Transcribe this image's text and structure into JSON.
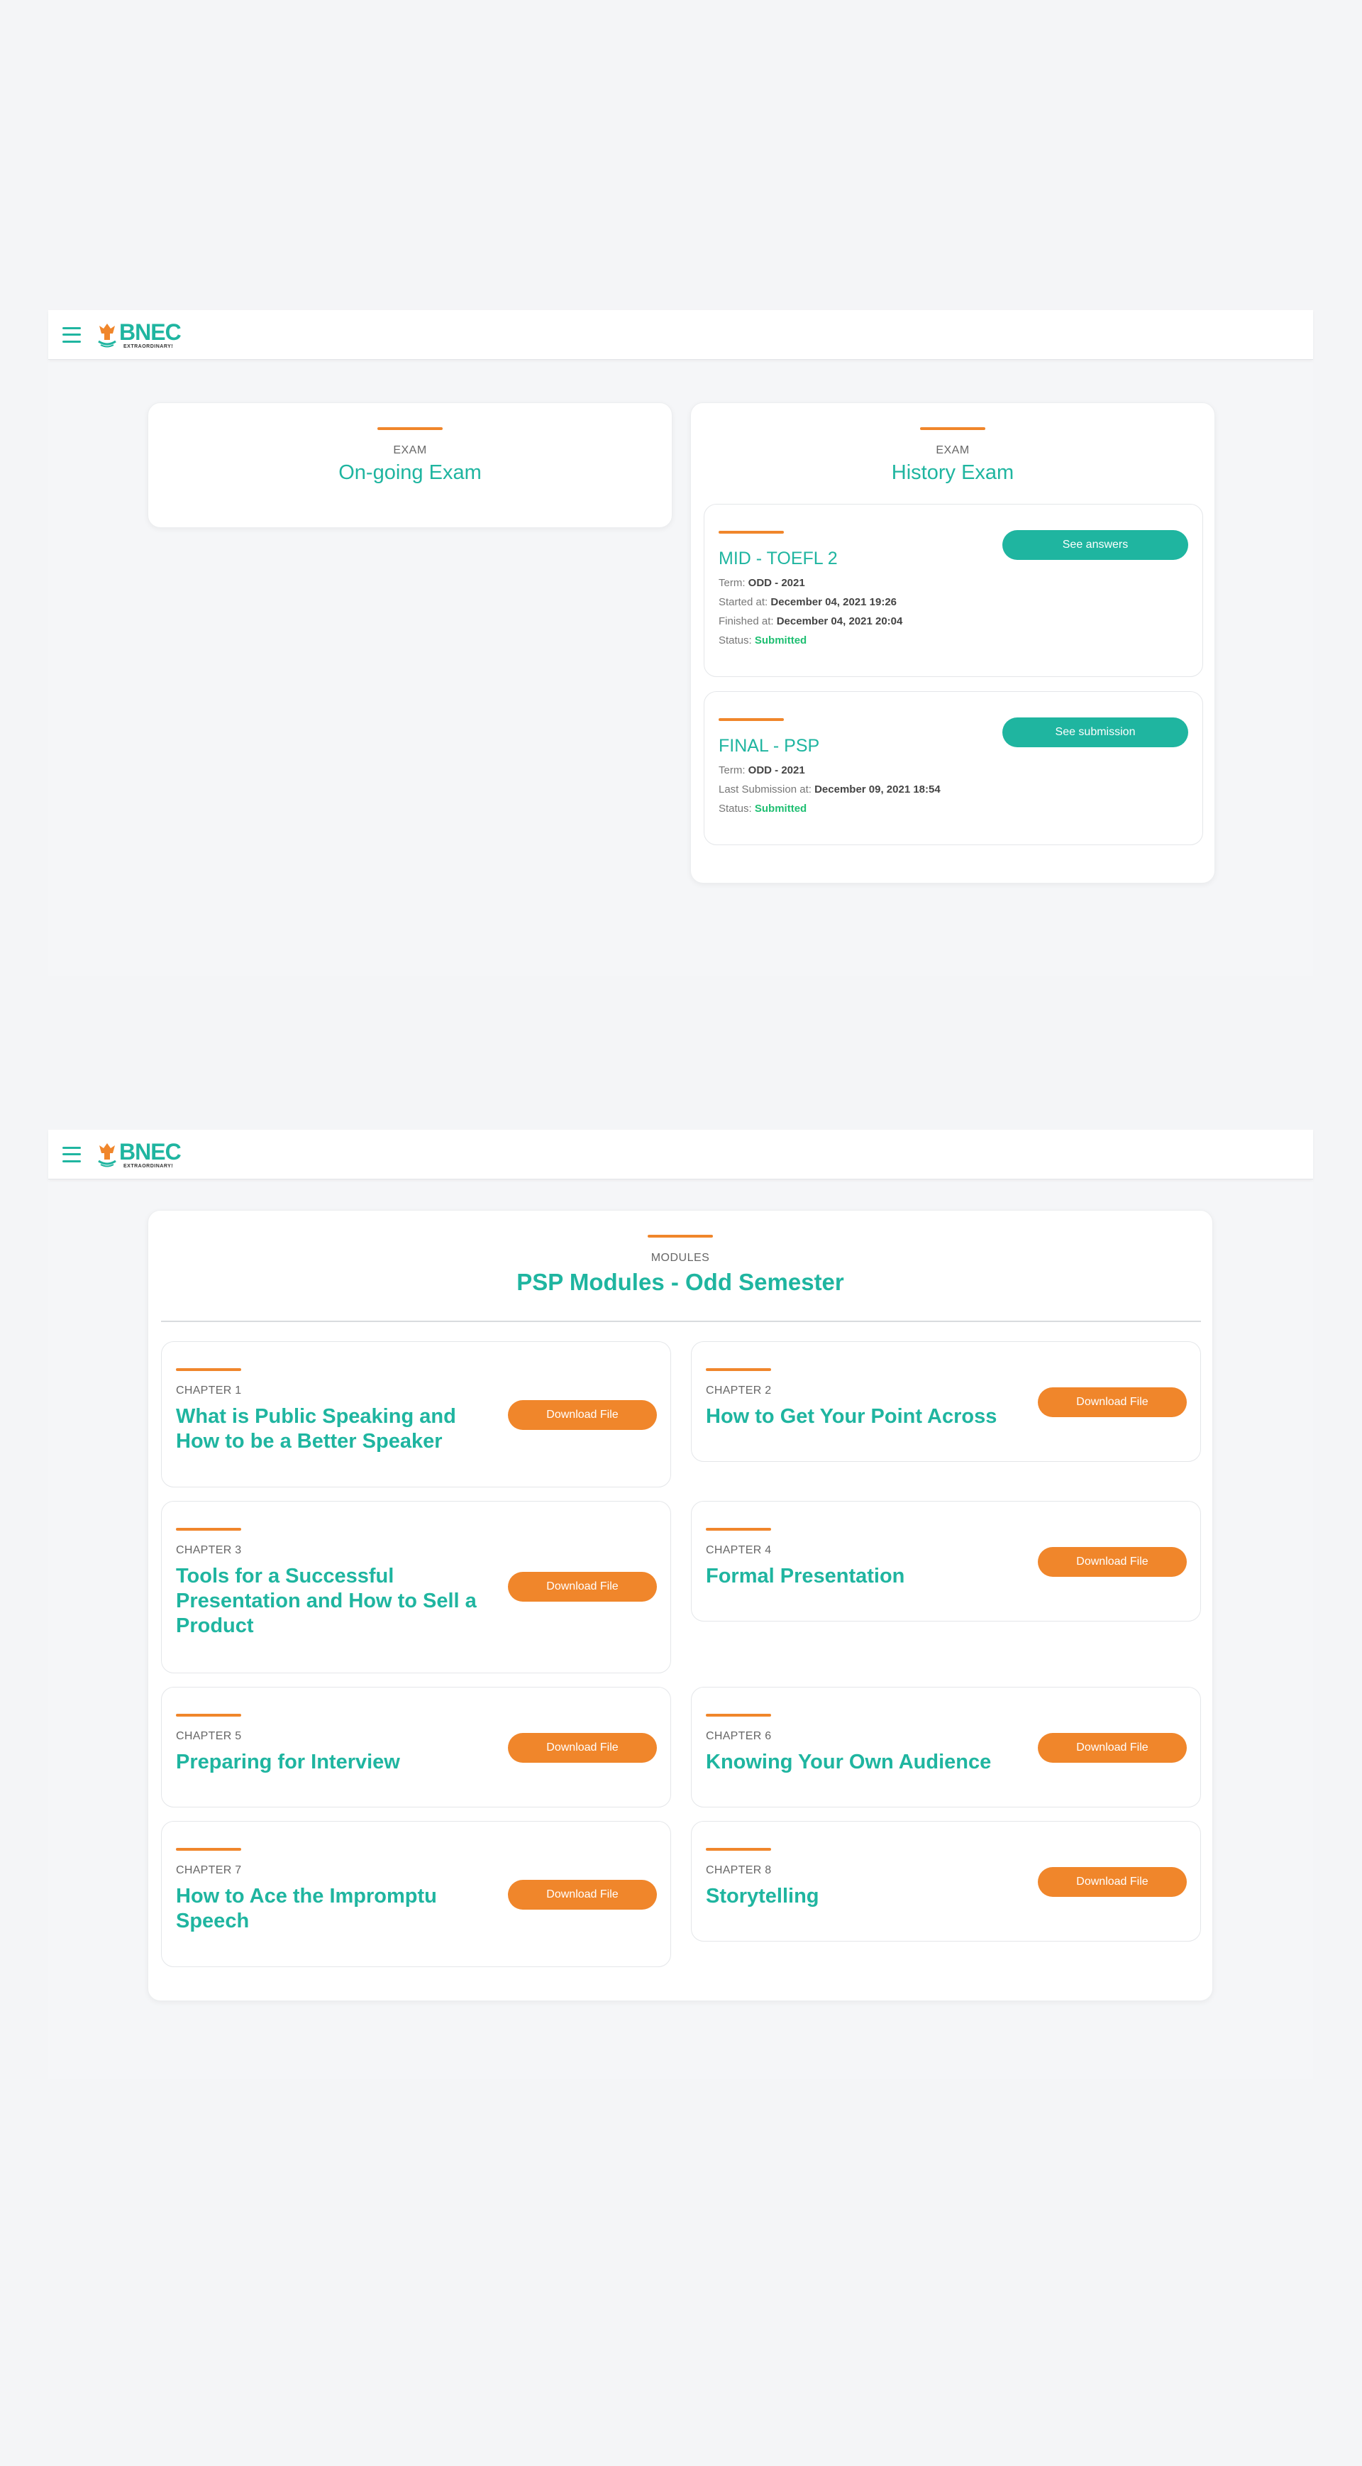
{
  "brand": {
    "name": "BNEC",
    "tagline": "EXTRAORDINARY!"
  },
  "exam_page": {
    "ongoing": {
      "caption": "EXAM",
      "title": "On-going Exam"
    },
    "history": {
      "caption": "EXAM",
      "title": "History Exam",
      "items": [
        {
          "title": "MID - TOEFL 2",
          "term_label": "Term:",
          "term": "ODD - 2021",
          "started_label": "Started at:",
          "started": "December 04, 2021 19:26",
          "finished_label": "Finished at:",
          "finished": "December 04, 2021 20:04",
          "status_label": "Status:",
          "status": "Submitted",
          "button": "See answers"
        },
        {
          "title": "FINAL - PSP",
          "term_label": "Term:",
          "term": "ODD - 2021",
          "submission_label": "Last Submission at:",
          "submission": "December 09, 2021 18:54",
          "status_label": "Status:",
          "status": "Submitted",
          "button": "See submission"
        }
      ]
    }
  },
  "modules_page": {
    "caption": "MODULES",
    "title": "PSP Modules - Odd Semester",
    "download_label": "Download File",
    "chapters": [
      {
        "chapter": "CHAPTER 1",
        "title": "What is Public Speaking and How to be a Better Speaker"
      },
      {
        "chapter": "CHAPTER 2",
        "title": "How to Get Your Point Across"
      },
      {
        "chapter": "CHAPTER 3",
        "title": "Tools for a Successful Presentation and How to Sell a Product"
      },
      {
        "chapter": "CHAPTER 4",
        "title": "Formal Presentation"
      },
      {
        "chapter": "CHAPTER 5",
        "title": "Preparing for Interview"
      },
      {
        "chapter": "CHAPTER 6",
        "title": "Knowing Your Own Audience"
      },
      {
        "chapter": "CHAPTER 7",
        "title": "How to Ace the Impromptu Speech"
      },
      {
        "chapter": "CHAPTER 8",
        "title": "Storytelling"
      }
    ]
  },
  "colors": {
    "brand_teal": "#1fb5a0",
    "accent_orange": "#f0862b",
    "status_green": "#1fbf72"
  },
  "icons": [
    "menu-icon",
    "bnec-logo"
  ]
}
